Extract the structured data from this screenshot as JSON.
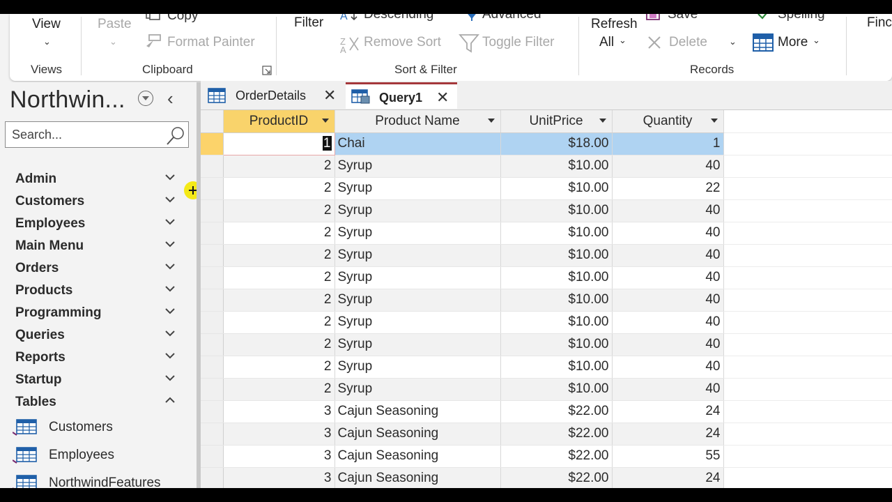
{
  "ribbon": {
    "views": {
      "view_label": "View",
      "group_label": "Views"
    },
    "clipboard": {
      "paste_label": "Paste",
      "copy_label": "Copy",
      "format_painter_label": "Format Painter",
      "group_label": "Clipboard"
    },
    "sort_filter": {
      "filter_label": "Filter",
      "descending_label": "Descending",
      "remove_sort_label": "Remove Sort",
      "advanced_label": "Advanced",
      "toggle_filter_label": "Toggle Filter",
      "group_label": "Sort & Filter"
    },
    "records": {
      "refresh_label": "Refresh",
      "refresh_all_label": "All",
      "save_label": "Save",
      "delete_label": "Delete",
      "spelling_label": "Spelling",
      "more_label": "More",
      "group_label": "Records"
    },
    "find": {
      "find_label": "Finc"
    }
  },
  "nav": {
    "title": "Northwin...",
    "search_placeholder": "Search...",
    "groups": [
      {
        "label": "Admin"
      },
      {
        "label": "Customers"
      },
      {
        "label": "Employees"
      },
      {
        "label": "Main Menu"
      },
      {
        "label": "Orders"
      },
      {
        "label": "Products"
      },
      {
        "label": "Programming"
      },
      {
        "label": "Queries"
      },
      {
        "label": "Reports"
      },
      {
        "label": "Startup"
      },
      {
        "label": "Tables"
      }
    ],
    "table_objects": [
      {
        "label": "Customers"
      },
      {
        "label": "Employees"
      },
      {
        "label": "NorthwindFeatures"
      }
    ]
  },
  "tabs": [
    {
      "label": "OrderDetails"
    },
    {
      "label": "Query1"
    }
  ],
  "datasheet": {
    "columns": [
      "ProductID",
      "Product Name",
      "UnitPrice",
      "Quantity"
    ],
    "rows": [
      {
        "product_id": "1",
        "product_name": "Chai",
        "unit_price": "$18.00",
        "quantity": "1"
      },
      {
        "product_id": "2",
        "product_name": "Syrup",
        "unit_price": "$10.00",
        "quantity": "40"
      },
      {
        "product_id": "2",
        "product_name": "Syrup",
        "unit_price": "$10.00",
        "quantity": "22"
      },
      {
        "product_id": "2",
        "product_name": "Syrup",
        "unit_price": "$10.00",
        "quantity": "40"
      },
      {
        "product_id": "2",
        "product_name": "Syrup",
        "unit_price": "$10.00",
        "quantity": "40"
      },
      {
        "product_id": "2",
        "product_name": "Syrup",
        "unit_price": "$10.00",
        "quantity": "40"
      },
      {
        "product_id": "2",
        "product_name": "Syrup",
        "unit_price": "$10.00",
        "quantity": "40"
      },
      {
        "product_id": "2",
        "product_name": "Syrup",
        "unit_price": "$10.00",
        "quantity": "40"
      },
      {
        "product_id": "2",
        "product_name": "Syrup",
        "unit_price": "$10.00",
        "quantity": "40"
      },
      {
        "product_id": "2",
        "product_name": "Syrup",
        "unit_price": "$10.00",
        "quantity": "40"
      },
      {
        "product_id": "2",
        "product_name": "Syrup",
        "unit_price": "$10.00",
        "quantity": "40"
      },
      {
        "product_id": "2",
        "product_name": "Syrup",
        "unit_price": "$10.00",
        "quantity": "40"
      },
      {
        "product_id": "3",
        "product_name": "Cajun Seasoning",
        "unit_price": "$22.00",
        "quantity": "24"
      },
      {
        "product_id": "3",
        "product_name": "Cajun Seasoning",
        "unit_price": "$22.00",
        "quantity": "24"
      },
      {
        "product_id": "3",
        "product_name": "Cajun Seasoning",
        "unit_price": "$22.00",
        "quantity": "55"
      },
      {
        "product_id": "3",
        "product_name": "Cajun Seasoning",
        "unit_price": "$22.00",
        "quantity": "24"
      }
    ]
  },
  "colors": {
    "accent_tab": "#a4373a",
    "selected_row": "#afd3f2",
    "selector_current": "#fcd36a",
    "cursor_highlight": "#f5e800"
  }
}
